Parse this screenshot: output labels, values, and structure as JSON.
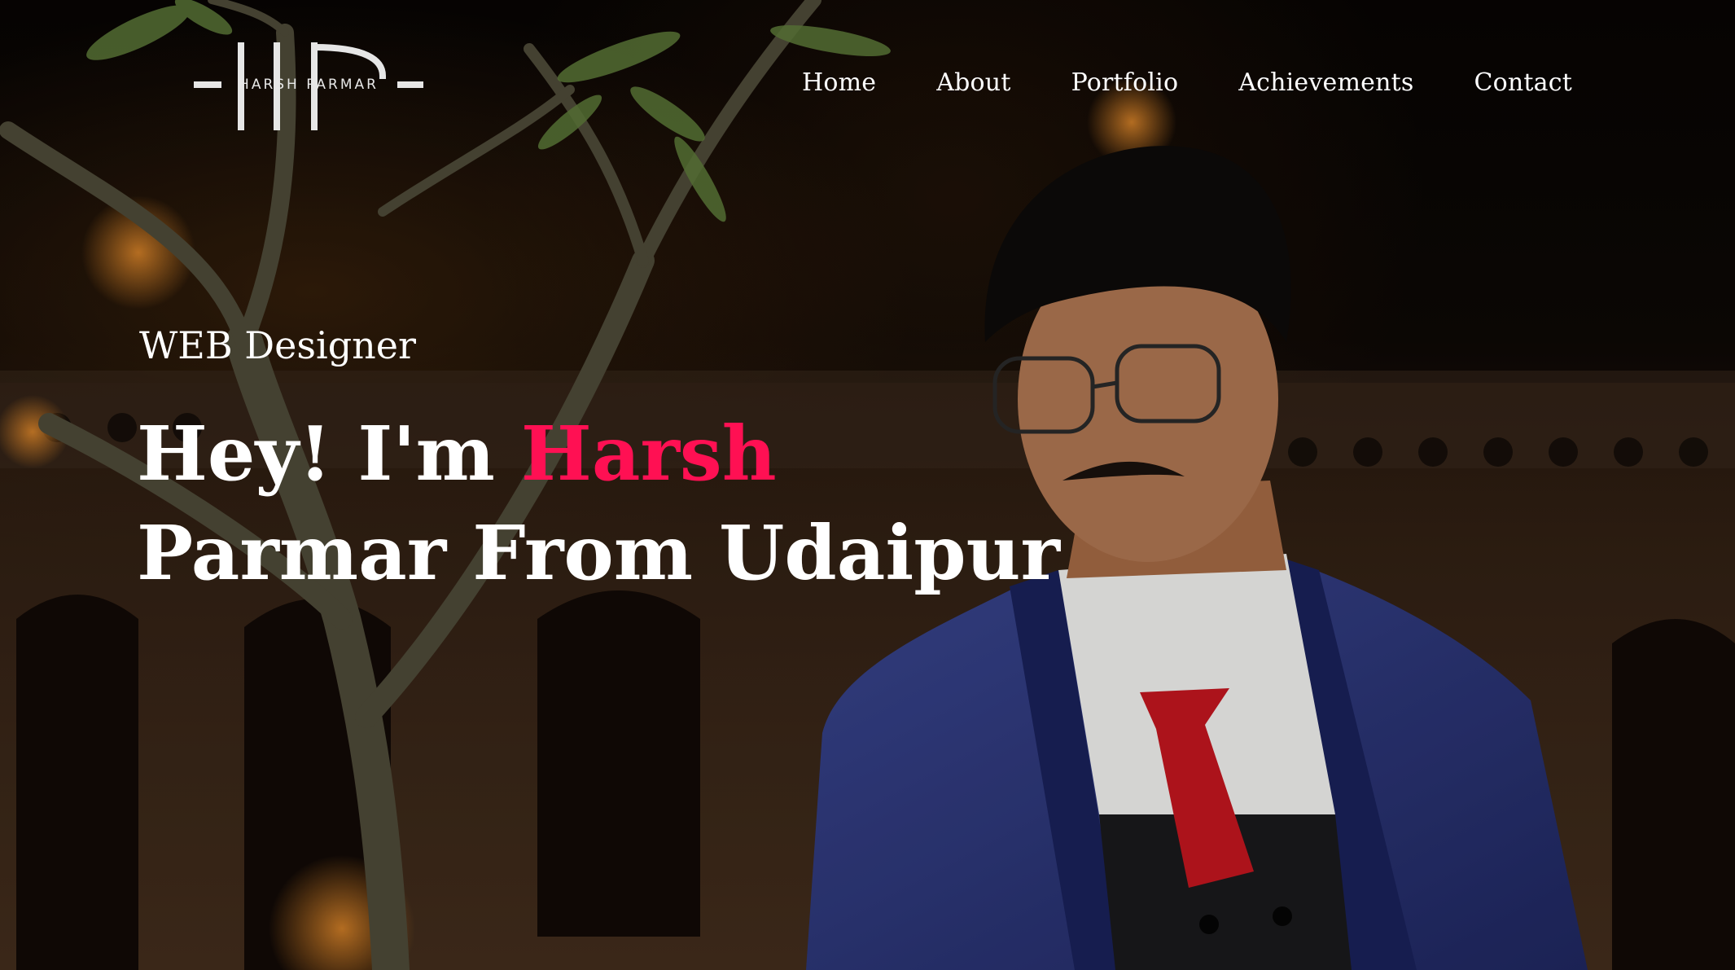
{
  "brand": {
    "logo_monogram": "HP",
    "logo_name": "HARSH PARMAR"
  },
  "nav": {
    "items": [
      {
        "label": "Home"
      },
      {
        "label": "About"
      },
      {
        "label": "Portfolio"
      },
      {
        "label": "Achievements"
      },
      {
        "label": "Contact"
      }
    ]
  },
  "hero": {
    "subtitle": "WEB Designer",
    "headline_prefix": "Hey! I'm ",
    "headline_name": "Harsh",
    "headline_line2": "Parmar From Udaipur",
    "accent_color": "#ff1053"
  },
  "colors": {
    "text": "#ffffff",
    "accent": "#ff1053",
    "background": "#0b0604"
  }
}
